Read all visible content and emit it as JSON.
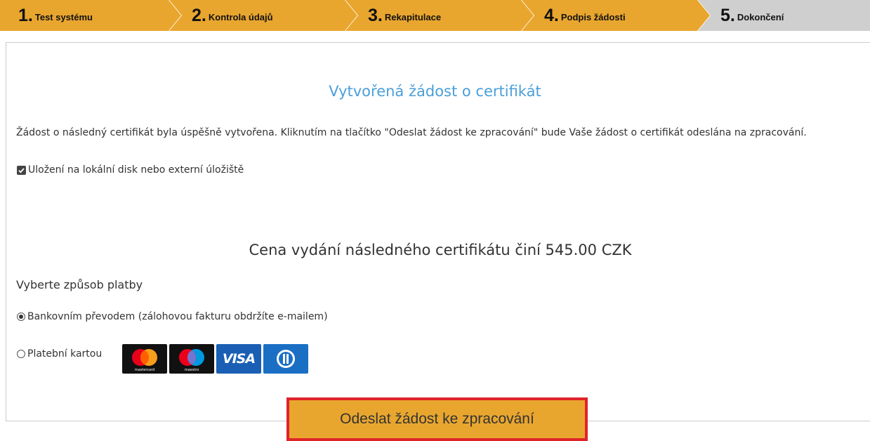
{
  "steps": [
    {
      "num": "1",
      "label": "Test systému",
      "state": "done"
    },
    {
      "num": "2",
      "label": "Kontrola údajů",
      "state": "done"
    },
    {
      "num": "3",
      "label": "Rekapitulace",
      "state": "done"
    },
    {
      "num": "4",
      "label": "Podpis žádosti",
      "state": "done"
    },
    {
      "num": "5",
      "label": "Dokončení",
      "state": "current"
    }
  ],
  "main": {
    "title": "Vytvořená žádost o certifikát",
    "description": "Žádost o následný certifikát byla úspěšně vytvořena. Kliknutím na tlačítko \"Odeslat žádost ke zpracování\" bude Vaše žádost o certifikát odeslána na zpracování.",
    "save_checkbox": {
      "label": "Uložení na lokální disk nebo externí úložiště",
      "checked": true
    },
    "price_text": "Cena vydání následného certifikátu činí 545.00 CZK",
    "payment_title": "Vyberte způsob platby",
    "payment_options": [
      {
        "label": "Bankovním převodem (zálohovou fakturu obdržíte e-mailem)",
        "selected": true
      },
      {
        "label": "Platební kartou",
        "selected": false
      }
    ],
    "card_logos": [
      "mastercard-icon",
      "maestro-icon",
      "visa-icon",
      "diners-icon"
    ],
    "card_text": {
      "mastercard": "mastercard",
      "maestro": "maestro",
      "visa": "VISA"
    },
    "submit_label": "Odeslat žádost ke zpracování"
  },
  "colors": {
    "accent": "#e9a62e",
    "step_inactive": "#cfcfcf",
    "title": "#4a9fd8",
    "highlight_border": "#e0232a"
  }
}
